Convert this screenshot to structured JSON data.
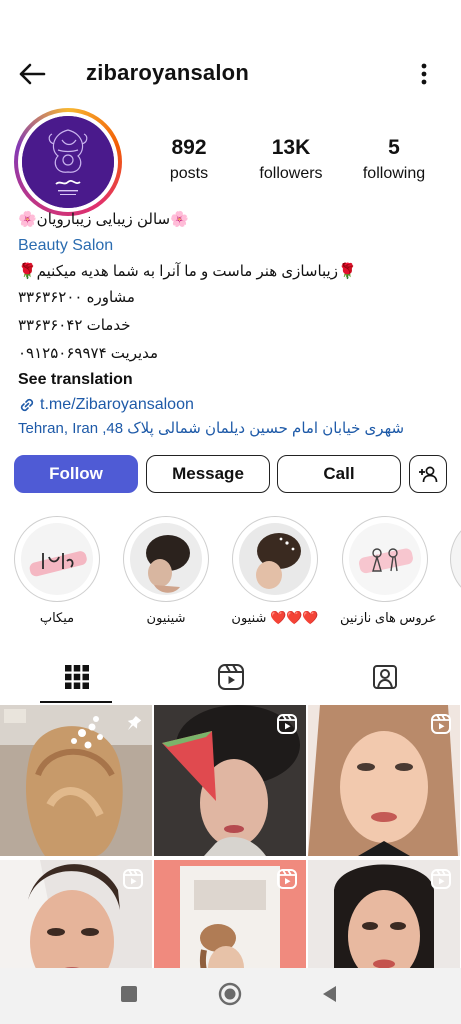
{
  "header": {
    "username": "zibaroyansalon"
  },
  "stats": [
    {
      "value": "892",
      "label": "posts"
    },
    {
      "value": "13K",
      "label": "followers"
    },
    {
      "value": "5",
      "label": "following"
    }
  ],
  "bio": {
    "name": "🌸سالن زیبایی زیبارویان🌸",
    "category": "Beauty Salon",
    "line1": "🌹زیباسازی هنر ماست و ما آنرا به شما هدیه میکنیم🌹",
    "line2": "مشاوره ۳۳۶۳۶۲۰۰",
    "line3": "خدمات ۳۳۶۳۶۰۴۲",
    "line4": "مدیریت ۰۹۱۲۵۰۶۹۹۷۴",
    "see_translation": "See translation",
    "link": "t.me/Zibaroyansaloon",
    "address": "شهری خیابان امام حسین دیلمان شمالی پلاک 48, Tehran, Iran"
  },
  "buttons": {
    "follow": "Follow",
    "message": "Message",
    "call": "Call"
  },
  "highlights": [
    {
      "label": "میکاپ"
    },
    {
      "label": "شینیون"
    },
    {
      "label": "شنیون",
      "suffix": "❤️❤️❤️"
    },
    {
      "label": "عروس های نازنین"
    }
  ],
  "colors": {
    "follow_button": "#4f5bd5",
    "link": "#1e5aa8",
    "avatar_bg": "#4a1a8c"
  }
}
